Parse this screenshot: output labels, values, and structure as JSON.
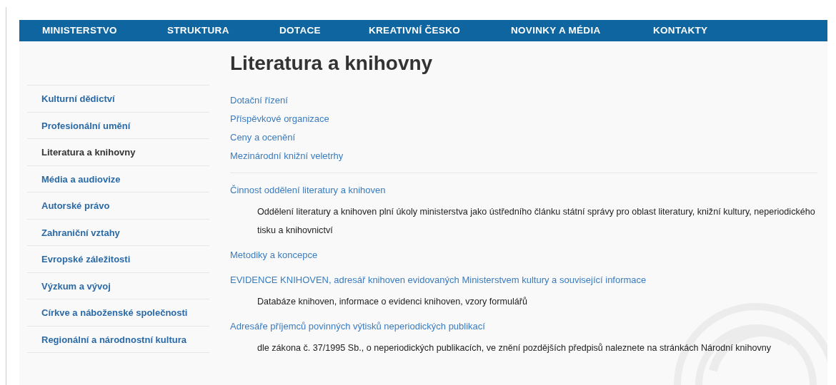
{
  "top_nav": [
    "MINISTERSTVO",
    "STRUKTURA",
    "DOTACE",
    "KREATIVNÍ ČESKO",
    "NOVINKY A MÉDIA",
    "KONTAKTY"
  ],
  "page_title": "Literatura a knihovny",
  "sidebar": {
    "items": [
      {
        "label": "Kulturní dědictví",
        "selected": false
      },
      {
        "label": "Profesionální umění",
        "selected": false
      },
      {
        "label": "Literatura a knihovny",
        "selected": true
      },
      {
        "label": "Média a audiovize",
        "selected": false
      },
      {
        "label": "Autorské právo",
        "selected": false
      },
      {
        "label": "Zahraniční vztahy",
        "selected": false
      },
      {
        "label": "Evropské záležitosti",
        "selected": false
      },
      {
        "label": "Výzkum a vývoj",
        "selected": false
      },
      {
        "label": "Církve a náboženské společnosti",
        "selected": false
      },
      {
        "label": "Regionální a národnostní kultura",
        "selected": false
      }
    ]
  },
  "quick_links": [
    "Dotační řízení",
    "Příspěvkové organizace",
    "Ceny a ocenění",
    "Mezinárodní knižní veletrhy"
  ],
  "sections": [
    {
      "title": "Činnost oddělení literatury a knihoven",
      "description": "Oddělení literatury a knihoven plní úkoly ministerstva jako ústředního článku státní správy pro oblast literatury, knižní kultury, neperiodického tisku a knihovnictví"
    },
    {
      "title": "Metodiky a koncepce"
    },
    {
      "title": "EVIDENCE KNIHOVEN, adresář knihoven evidovaných Ministerstvem kultury a související informace",
      "description": "Databáze knihoven, informace o evidenci knihoven, vzory formulářů"
    },
    {
      "title": "Adresáře příjemců povinných výtisků neperiodických publikací",
      "description": "dle zákona č. 37/1995 Sb., o neperiodických publikacích, ve znění pozdějších předpisů naleznete na stránkách Národní knihovny"
    }
  ]
}
